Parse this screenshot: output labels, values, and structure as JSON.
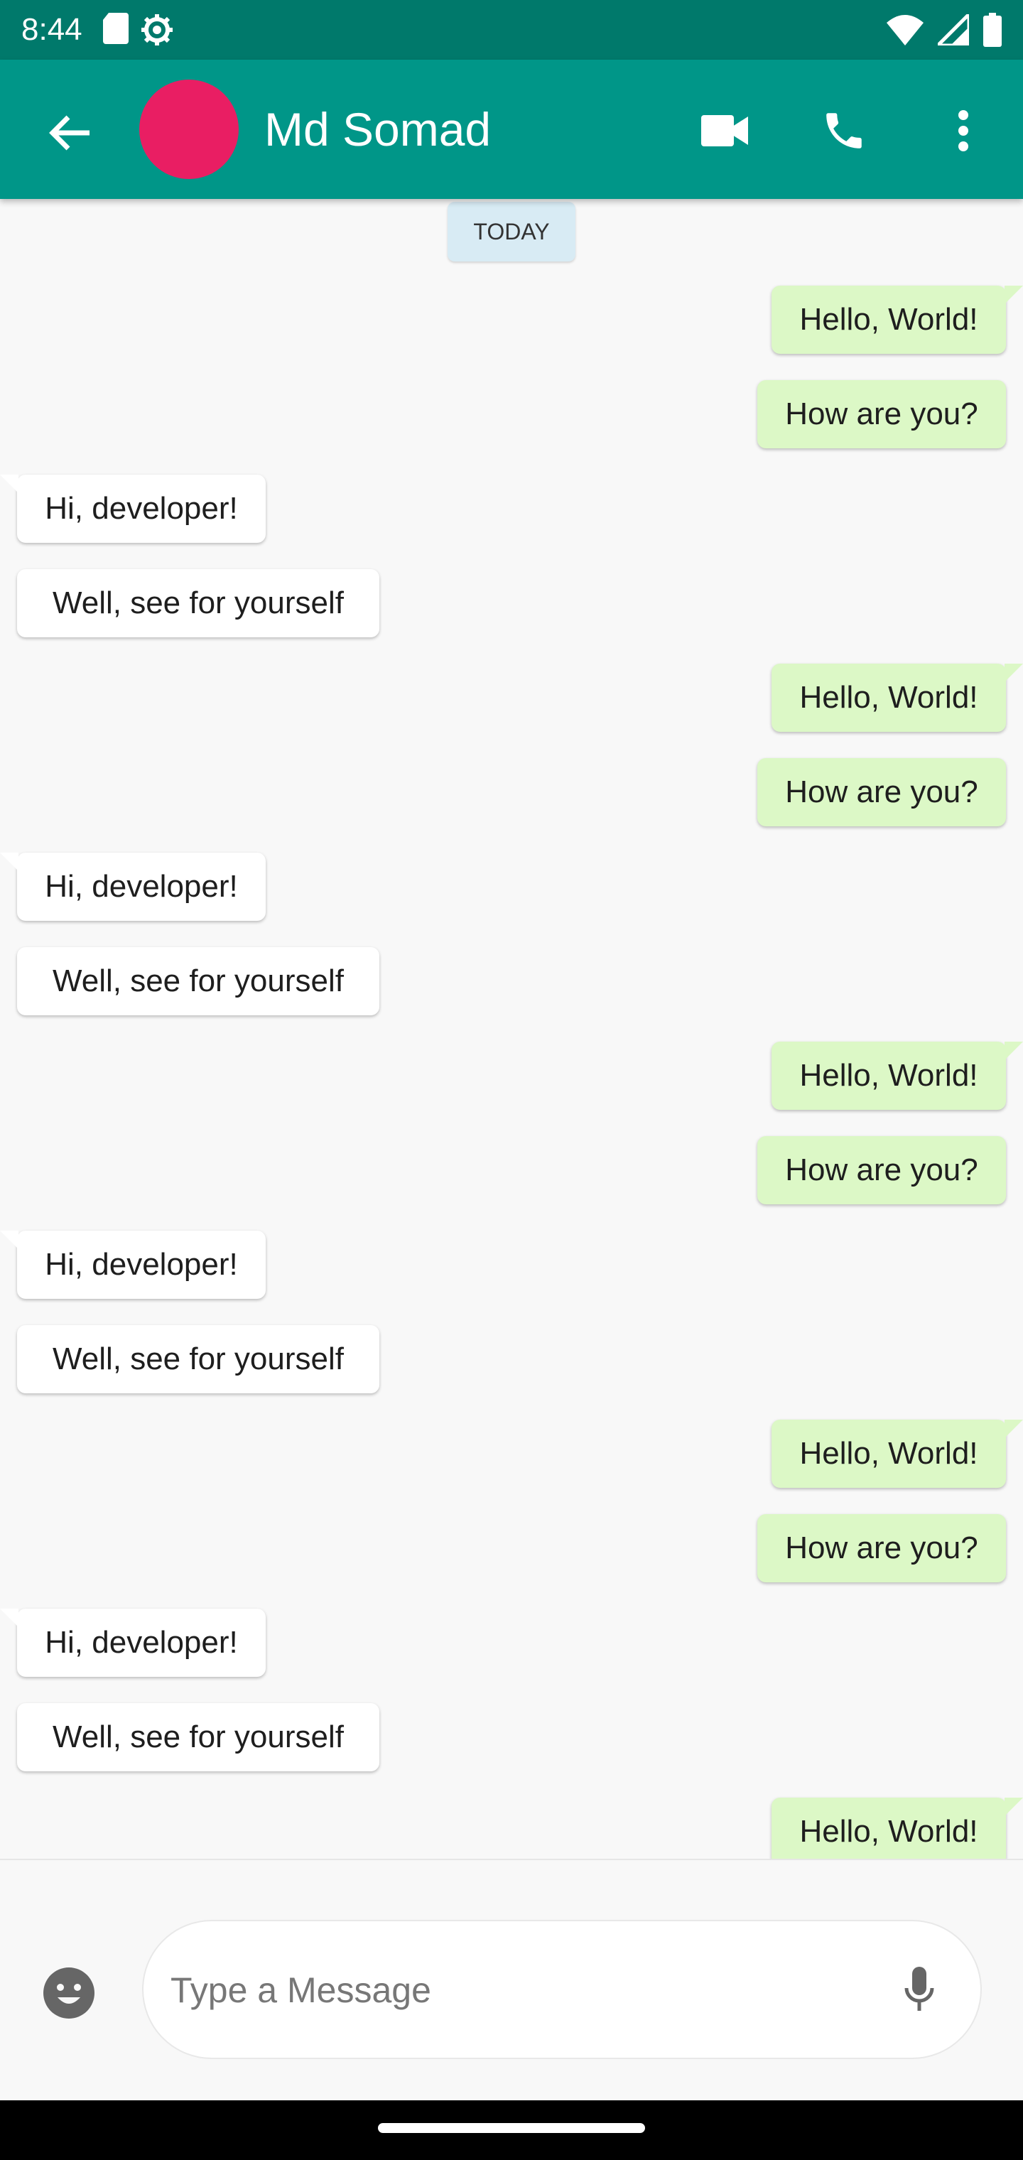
{
  "status_bar": {
    "time": "8:44",
    "icons": [
      "sd-card-icon",
      "settings-gear-icon",
      "wifi-icon",
      "cell-signal-icon",
      "battery-icon"
    ]
  },
  "app_bar": {
    "contact_name": "Md Somad",
    "avatar_color": "#e91e63",
    "bar_color": "#009688",
    "status_color": "#00796b",
    "actions": [
      "video-call-icon",
      "phone-icon",
      "more-vert-icon"
    ]
  },
  "chat": {
    "date_label": "TODAY",
    "outgoing_color": "#dcf8c6",
    "incoming_color": "#ffffff",
    "messages": [
      {
        "dir": "out",
        "text": "Hello, World!"
      },
      {
        "dir": "out",
        "text": "How are you?"
      },
      {
        "dir": "in",
        "text": "Hi, developer!"
      },
      {
        "dir": "in",
        "text": "Well, see for yourself"
      },
      {
        "dir": "out",
        "text": "Hello, World!"
      },
      {
        "dir": "out",
        "text": "How are you?"
      },
      {
        "dir": "in",
        "text": "Hi, developer!"
      },
      {
        "dir": "in",
        "text": "Well, see for yourself"
      },
      {
        "dir": "out",
        "text": "Hello, World!"
      },
      {
        "dir": "out",
        "text": "How are you?"
      },
      {
        "dir": "in",
        "text": "Hi, developer!"
      },
      {
        "dir": "in",
        "text": "Well, see for yourself"
      },
      {
        "dir": "out",
        "text": "Hello, World!"
      },
      {
        "dir": "out",
        "text": "How are you?"
      },
      {
        "dir": "in",
        "text": "Hi, developer!"
      },
      {
        "dir": "in",
        "text": "Well, see for yourself"
      },
      {
        "dir": "out",
        "text": "Hello, World!"
      }
    ]
  },
  "composer": {
    "placeholder": "Type a Message",
    "value": ""
  }
}
